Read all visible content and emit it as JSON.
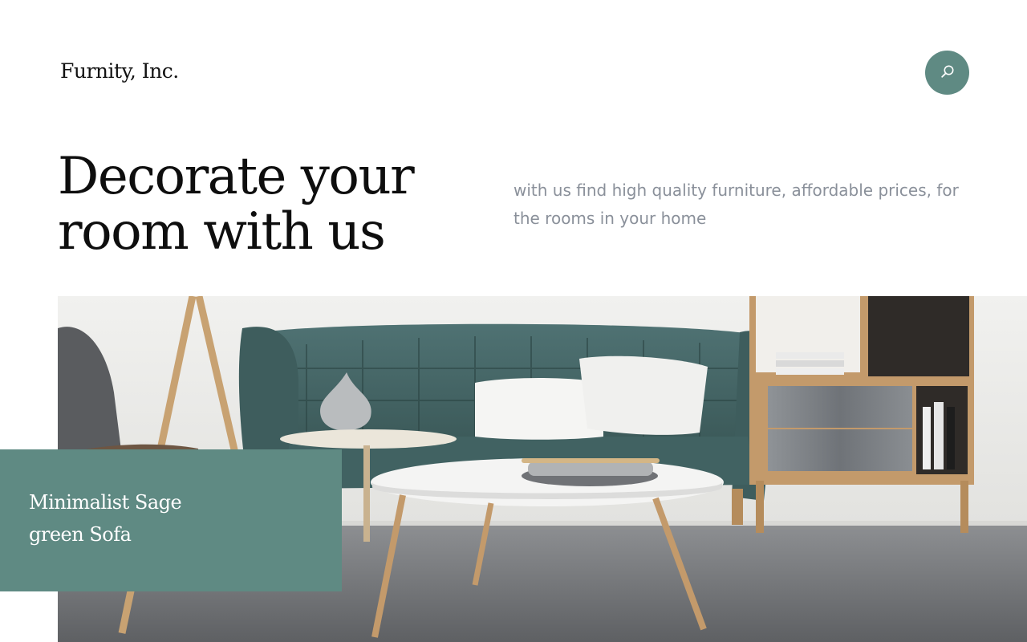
{
  "header": {
    "brand": "Furnity, Inc.",
    "search_icon": "search-icon"
  },
  "hero": {
    "title": "Decorate your room with us",
    "subtitle": "with us find high quality furniture, affordable prices, for the rooms in your home"
  },
  "feature": {
    "caption": "Minimalist Sage green Sofa"
  },
  "colors": {
    "accent": "#5f8a83",
    "title": "#0e0e0e",
    "subtitle": "#8a909a",
    "background": "#ffffff"
  }
}
